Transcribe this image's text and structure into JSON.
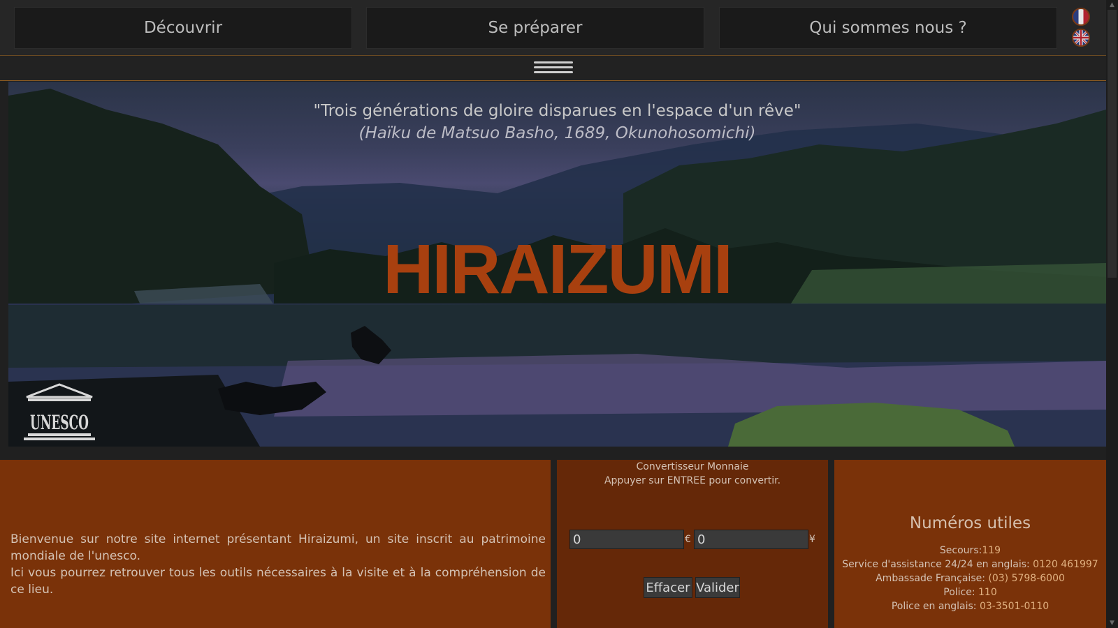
{
  "nav": {
    "items": [
      {
        "label": "Découvrir"
      },
      {
        "label": "Se préparer"
      },
      {
        "label": "Qui sommes nous ?"
      }
    ],
    "languages": [
      {
        "icon": "french-flag-icon"
      },
      {
        "icon": "uk-flag-icon"
      }
    ],
    "menu_icon": "hamburger-menu-icon"
  },
  "hero": {
    "quote": "\"Trois générations de gloire disparues en l'espace d'un rêve\"",
    "quote_source": "(Haïku de Matsuo Basho, 1689, Okunohosomichi)",
    "title": "HIRAIZUMI",
    "logo_text": "UNESCO",
    "title_color": "#a8400f"
  },
  "welcome": {
    "line1": "Bienvenue sur notre site internet présentant Hiraizumi, un site inscrit au patrimoine mondiale de l'unesco.",
    "line2": "Ici vous pourrez retrouver tous les outils nécessaires à la visite et à la compréhension de ce lieu."
  },
  "converter": {
    "title": "Convertisseur Monnaie",
    "hint": "Appuyer sur ENTREE pour convertir.",
    "eur_value": "0",
    "eur_symbol": "€",
    "yen_value": "0",
    "yen_symbol": "¥",
    "clear_label": "Effacer",
    "submit_label": "Valider"
  },
  "useful_numbers": {
    "title": "Numéros utiles",
    "items": [
      {
        "label": "Secours:",
        "value": "119"
      },
      {
        "label": "Service d'assistance 24/24 en anglais: ",
        "value": "0120 461997"
      },
      {
        "label": "Ambassade Française: ",
        "value": "(03) 5798-6000"
      },
      {
        "label": "Police: ",
        "value": "110"
      },
      {
        "label": "Police en anglais: ",
        "value": "03-3501-0110"
      }
    ]
  },
  "colors": {
    "panel_orange": "#7a3209",
    "panel_dark_orange": "#652808",
    "background": "#202020"
  }
}
